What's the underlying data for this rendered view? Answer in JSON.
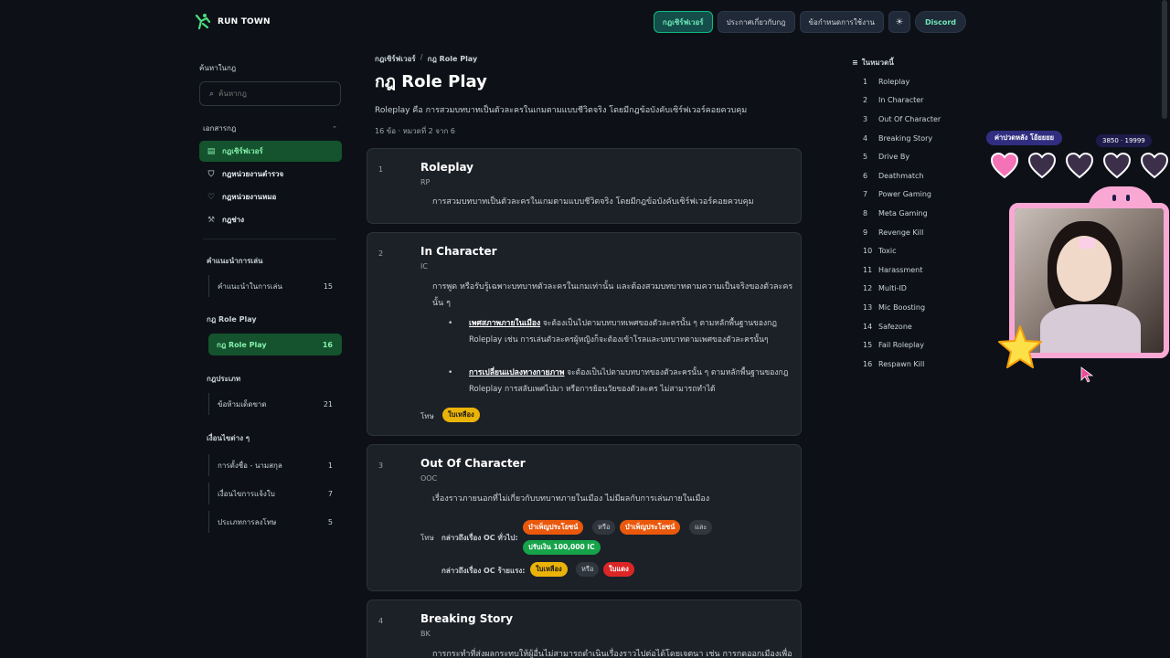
{
  "header": {
    "brand": "RUN TOWN",
    "nav": [
      {
        "label": "กฎเซิร์ฟเวอร์",
        "active": true
      },
      {
        "label": "ประกาศเกี่ยวกับกฎ",
        "active": false
      },
      {
        "label": "ข้อกำหนดการใช้งาน",
        "active": false
      }
    ],
    "theme_icon": "sun-icon",
    "discord_label": "Discord"
  },
  "sidebar": {
    "search_label": "ค้นหาในกฎ",
    "search_placeholder": "ค้นหากฎ",
    "docs_label": "เอกสารกฎ",
    "docs": [
      {
        "label": "กฎเซิร์ฟเวอร์",
        "icon": "book-icon",
        "active": true
      },
      {
        "label": "กฎหน่วยงานตำรวจ",
        "icon": "shield-icon",
        "active": false
      },
      {
        "label": "กฎหน่วยงานหมอ",
        "icon": "heart-pulse-icon",
        "active": false
      },
      {
        "label": "กฎช่าง",
        "icon": "wrench-icon",
        "active": false
      }
    ],
    "groups": [
      {
        "label": "คำแนะนำการเล่น",
        "items": [
          {
            "label": "คำแนะนำในการเล่น",
            "count": "15",
            "active": false
          }
        ]
      },
      {
        "label": "กฎ Role Play",
        "items": [
          {
            "label": "กฎ Role Play",
            "count": "16",
            "active": true
          }
        ]
      },
      {
        "label": "กฎประเภท",
        "items": [
          {
            "label": "ข้อห้ามเด็ดขาด",
            "count": "21",
            "active": false
          }
        ]
      },
      {
        "label": "เงื่อนไขต่าง ๆ",
        "items": [
          {
            "label": "การตั้งชื่อ - นามสกุล",
            "count": "1",
            "active": false
          },
          {
            "label": "เงื่อนไขการแจ้งใบ",
            "count": "7",
            "active": false
          },
          {
            "label": "ประเภทการลงโทษ",
            "count": "5",
            "active": false
          }
        ]
      }
    ]
  },
  "main": {
    "breadcrumb": [
      "กฎเซิร์ฟเวอร์",
      "กฎ Role Play"
    ],
    "title": "กฎ Role Play",
    "description": "Roleplay คือ การสวมบทบาทเป็นตัวละครในเกมตามแบบชีวิตจริง โดยมีกฎข้อบังคับเซิร์ฟเวอร์คอยควบคุม",
    "meta": "16 ข้อ · หมวดที่ 2 จาก 6",
    "rules": [
      {
        "num": "1",
        "title": "Roleplay",
        "abbr": "RP",
        "body": "การสวมบทบาทเป็นตัวละครในเกมตามแบบชีวิตจริง โดยมีกฎข้อบังคับเซิร์ฟเวอร์คอยควบคุม"
      },
      {
        "num": "2",
        "title": "In Character",
        "abbr": "IC",
        "body": "การพูด หรือรับรู้เฉพาะบทบาทตัวละครในเกมเท่านั้น และต้องสวมบทบาทตามความเป็นจริงของตัวละคร นั้น ๆ",
        "bullets": [
          {
            "strong": "เพศสภาพภายในเมือง",
            "text": " จะต้องเป็นไปตามบทบาทเพศของตัวละครนั้น ๆ ตามหลักพื้นฐานของกฎ Roleplay เช่น การเล่นตัวละครผู้หญิงก็จะต้องเข้าโรลและบทบาทตามเพศของตัวละครนั้นๆ"
          },
          {
            "strong": "การเปลี่ยนแปลงทางกายภาพ",
            "text": " จะต้องเป็นไปตามบทบาทของตัวละครนั้น ๆ ตามหลักพื้นฐานของกฎ Roleplay การสลับเพศไปมา หรือการย้อนวัยของตัวละคร ไม่สามารถทำได้"
          }
        ],
        "penalty_label": "โทษ",
        "penalty": "ใบเหลือง"
      },
      {
        "num": "3",
        "title": "Out Of Character",
        "abbr": "OOC",
        "body": "เรื่องราวภายนอกที่ไม่เกี่ยวกับบทบาทภายในเมือง ไม่มีผลกับการเล่นภายในเมือง",
        "penalty_label": "โทษ",
        "row1_label": "กล่าวถึงเรื่อง OC ทั่วไป:",
        "row1_tags": [
          "บำเพ็ญประโยชน์",
          "หรือ",
          "บำเพ็ญประโยชน์",
          "และ",
          "ปรับเงิน 100,000 IC"
        ],
        "row2_label": "กล่าวถึงเรื่อง OC ร้ายแรง:",
        "row2_tags": [
          "ใบเหลือง",
          "หรือ",
          "ใบแดง"
        ]
      },
      {
        "num": "4",
        "title": "Breaking Story",
        "abbr": "BK",
        "body": "การกระทำที่ส่งผลกระทบให้ผู้อื่นไม่สามารถดำเนินเรื่องราวไปต่อได้โดยเจตนา เช่น การกดออกเมืองเพื่อ"
      }
    ]
  },
  "toc": {
    "label": "ในหมวดนี้",
    "items": [
      "Roleplay",
      "In Character",
      "Out Of Character",
      "Breaking Story",
      "Drive By",
      "Deathmatch",
      "Power Gaming",
      "Meta Gaming",
      "Revenge Kill",
      "Toxic",
      "Harassment",
      "Multi-ID",
      "Mic Boosting",
      "Safezone",
      "Fail Roleplay",
      "Respawn Kill"
    ]
  },
  "overlay": {
    "hp_label": "ค่าปวดหลัง โอ้ยยยย",
    "hp_count": "3850 · 19999",
    "hearts_filled": 1,
    "hearts_total": 5
  }
}
